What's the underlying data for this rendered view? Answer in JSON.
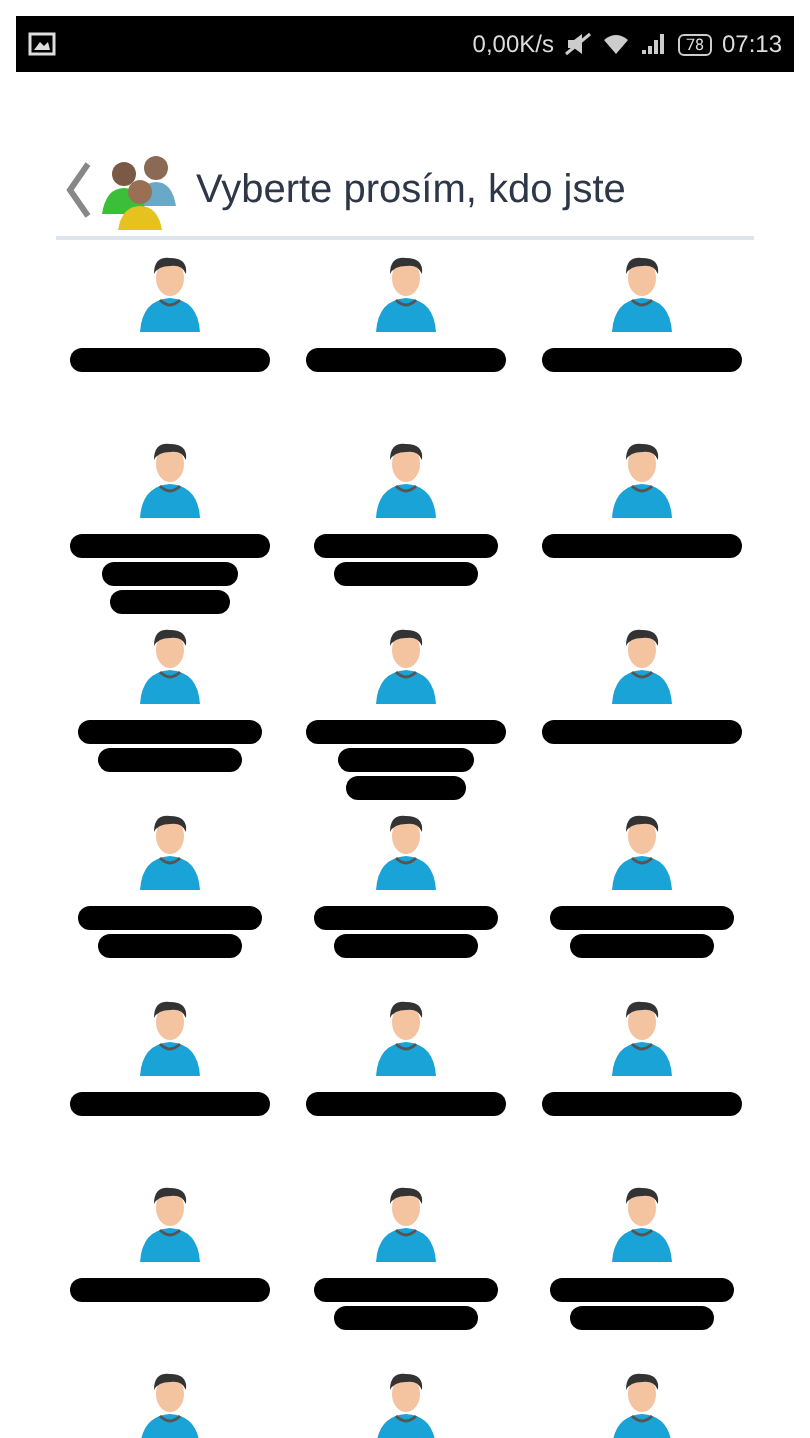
{
  "status_bar": {
    "speed": "0,00K/s",
    "battery": "78",
    "time": "07:13"
  },
  "header": {
    "title": "Vyberte prosím, kdo jste"
  },
  "users": [
    {
      "kind": "single"
    },
    {
      "kind": "single"
    },
    {
      "kind": "single"
    },
    {
      "kind": "triple"
    },
    {
      "kind": "double"
    },
    {
      "kind": "single"
    },
    {
      "kind": "double"
    },
    {
      "kind": "triple"
    },
    {
      "kind": "single"
    },
    {
      "kind": "double"
    },
    {
      "kind": "double"
    },
    {
      "kind": "double"
    },
    {
      "kind": "single"
    },
    {
      "kind": "single"
    },
    {
      "kind": "single"
    },
    {
      "kind": "single"
    },
    {
      "kind": "double"
    },
    {
      "kind": "double"
    },
    {
      "kind": "hidden"
    },
    {
      "kind": "hidden"
    },
    {
      "kind": "hidden"
    }
  ]
}
